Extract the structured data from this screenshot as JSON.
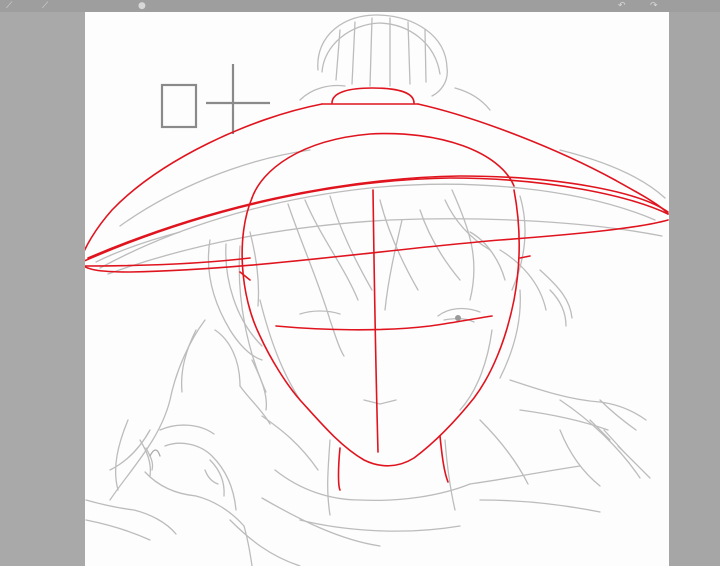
{
  "app": {
    "toolbar_icons": [
      {
        "name": "brush-tool-icon",
        "glyph": "⟋"
      },
      {
        "name": "eraser-tool-icon",
        "glyph": "⟋"
      },
      {
        "name": "layer-tool-icon",
        "glyph": "●"
      },
      {
        "name": "undo-icon",
        "glyph": "↶"
      },
      {
        "name": "redo-icon",
        "glyph": "↷"
      }
    ]
  },
  "canvas": {
    "background_color": "#fdfdfd",
    "sketch_color": "#b9b9b9",
    "construction_color": "#e0141e",
    "marker_color": "#8a8a8a"
  }
}
